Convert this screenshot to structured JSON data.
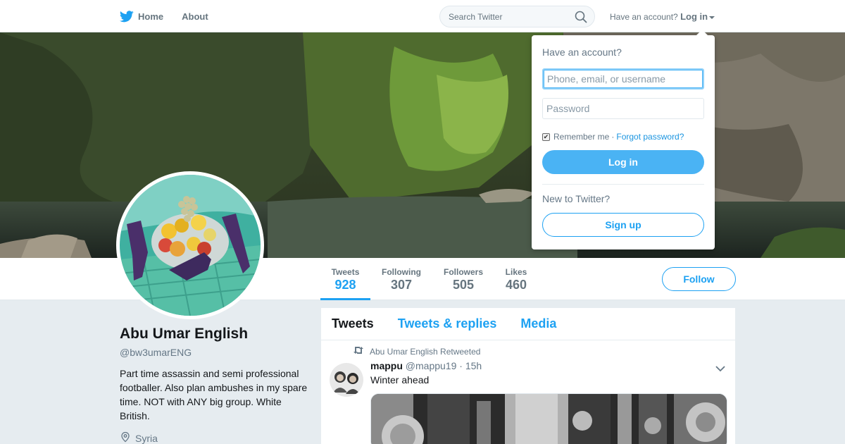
{
  "nav": {
    "home_label": "Home",
    "about_label": "About",
    "search_placeholder": "Search Twitter",
    "account_prompt": "Have an account?",
    "login_label": "Log in"
  },
  "profile": {
    "name": "Abu Umar English",
    "handle": "@bw3umarENG",
    "bio": "Part time assassin and semi professional footballer. Also plan ambushes in my spare time. NOT with ANY big group. White British.",
    "location": "Syria"
  },
  "stats": [
    {
      "label": "Tweets",
      "value": "928"
    },
    {
      "label": "Following",
      "value": "307"
    },
    {
      "label": "Followers",
      "value": "505"
    },
    {
      "label": "Likes",
      "value": "460"
    }
  ],
  "follow_label": "Follow",
  "timeline": {
    "tabs": [
      "Tweets",
      "Tweets & replies",
      "Media"
    ],
    "tweet": {
      "retweeted_by": "Abu Umar English Retweeted",
      "author_name": "mappu",
      "author_handle": "@mappu19",
      "separator": "·",
      "time": "15h",
      "text": "Winter ahead"
    }
  },
  "login_dropdown": {
    "title": "Have an account?",
    "username_placeholder": "Phone, email, or username",
    "password_placeholder": "Password",
    "remember_label": "Remember me",
    "separator": "·",
    "forgot_label": "Forgot password?",
    "login_button": "Log in",
    "new_prompt": "New to Twitter?",
    "signup_button": "Sign up"
  },
  "colors": {
    "accent": "#1da1f2",
    "login_button": "#4ab3f4",
    "page_bg": "#e6ecf0"
  }
}
